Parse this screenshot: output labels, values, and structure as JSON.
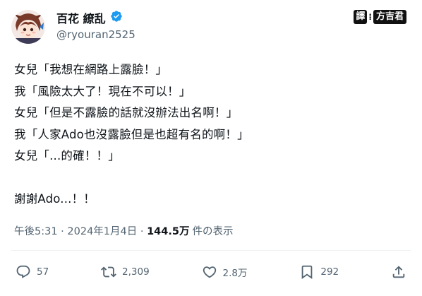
{
  "author": {
    "display_name": "百花 繚乱",
    "handle": "@ryouran2525"
  },
  "watermark": {
    "badge": "譯",
    "separator": "⁞",
    "name": "方吉君"
  },
  "tweet": {
    "lines": [
      "女兒「我想在網路上露臉！」",
      "我「風險太大了！現在不可以！」",
      "女兒「但是不露臉的話就沒辦法出名啊！」",
      "我「人家Ado也沒露臉但是也超有名的啊！」",
      "女兒「...的確！！」"
    ],
    "closing": "謝謝Ado...！！"
  },
  "meta": {
    "timestamp": "午後5:31 · 2024年1月4日 · ",
    "views": "144.5万",
    "views_label": "件の表示"
  },
  "actions": {
    "replies": "57",
    "reposts": "2,309",
    "likes": "2.8万",
    "bookmarks": "292"
  },
  "colors": {
    "verified": "#1d9bf0",
    "secondary_text": "#536471",
    "primary_text": "#0f1419"
  },
  "icons": [
    "avatar",
    "verified-badge-icon",
    "reply-icon",
    "repost-icon",
    "like-icon",
    "bookmark-icon",
    "share-icon"
  ]
}
